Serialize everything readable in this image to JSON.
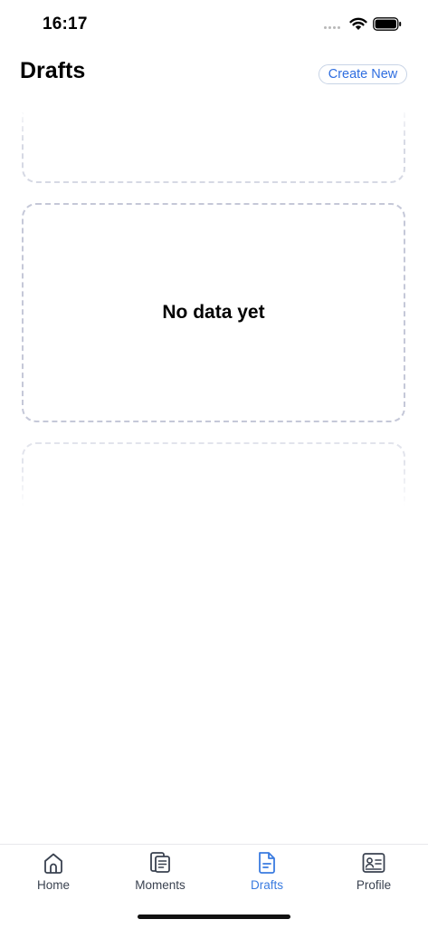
{
  "status_bar": {
    "time": "16:17"
  },
  "header": {
    "title": "Drafts",
    "create_label": "Create New"
  },
  "main": {
    "empty_message": "No data yet"
  },
  "tab_bar": {
    "items": [
      {
        "label": "Home",
        "icon": "home-icon",
        "active": false
      },
      {
        "label": "Moments",
        "icon": "moments-icon",
        "active": false
      },
      {
        "label": "Drafts",
        "icon": "document-icon",
        "active": true
      },
      {
        "label": "Profile",
        "icon": "id-card-icon",
        "active": false
      }
    ]
  },
  "colors": {
    "accent": "#3a7be0",
    "dashed_border": "#c5c8d8",
    "tab_text": "#3a4250"
  }
}
